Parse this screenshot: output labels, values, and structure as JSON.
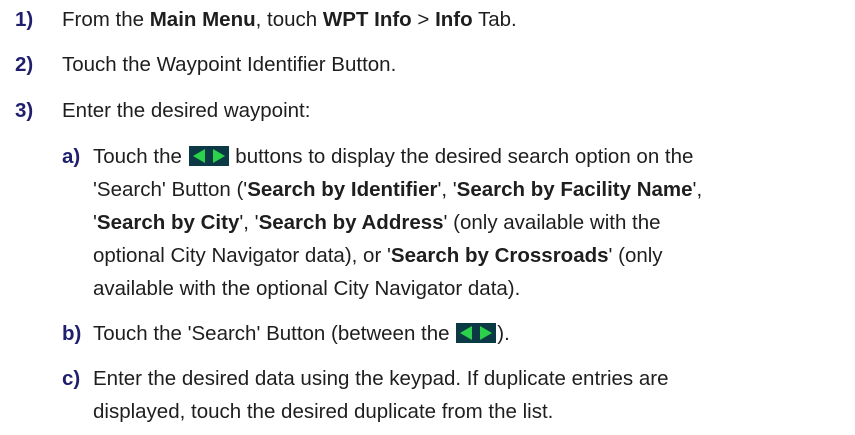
{
  "steps": [
    {
      "num": "1)",
      "parts": [
        "From the ",
        "Main Menu",
        ", touch ",
        "WPT Info",
        " > ",
        "Info",
        " Tab."
      ]
    },
    {
      "num": "2)",
      "text": "Touch the Waypoint Identifier Button."
    },
    {
      "num": "3)",
      "text": "Enter the desired waypoint:",
      "substeps": [
        {
          "num": "a)",
          "l1a": "Touch the ",
          "l1b": " buttons to display the desired search option on the",
          "l2a": "'Search' Button ('",
          "l2b": "Search by Identifier",
          "l2c": "', '",
          "l2d": "Search by Facility Name",
          "l2e": "',",
          "l3a": "'",
          "l3b": "Search by City",
          "l3c": "',  '",
          "l3d": "Search by Address",
          "l3e": "' (only available with the",
          "l4": "optional City Navigator data), or '",
          "l4b": "Search by Crossroads",
          "l4c": "' (only",
          "l5": "available with the optional City Navigator data)."
        },
        {
          "num": "b)",
          "a": "Touch the 'Search' Button (between the ",
          "b": ")."
        },
        {
          "num": "c)",
          "l1": "Enter the desired data using the keypad.  If duplicate entries are",
          "l2": "displayed, touch the desired duplicate from the list."
        }
      ]
    }
  ],
  "icons": {
    "arrows": "left-right-arrow-buttons-icon"
  },
  "colors": {
    "number": "#1f1f6e",
    "icon_bg": "#0c3a44",
    "icon_arrow": "#2bd14a"
  }
}
